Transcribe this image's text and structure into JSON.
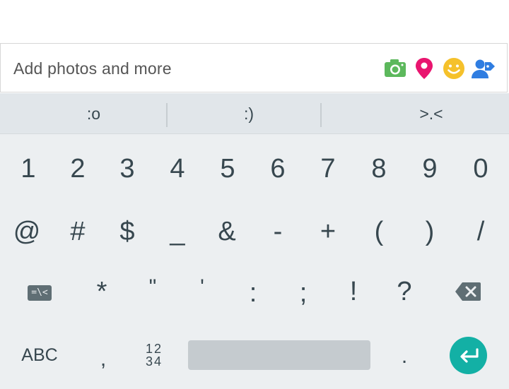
{
  "compose": {
    "placeholder": "Add photos and more",
    "icons": [
      "camera-icon",
      "location-pin-icon",
      "smiley-icon",
      "tag-person-icon"
    ],
    "colors": {
      "camera": "#5cb85c",
      "location": "#e9156f",
      "smiley": "#f5c12b",
      "tag": "#2f7de1"
    }
  },
  "suggestions": [
    ":o",
    ":)",
    ">.<"
  ],
  "keyboard": {
    "number_row": [
      "1",
      "2",
      "3",
      "4",
      "5",
      "6",
      "7",
      "8",
      "9",
      "0"
    ],
    "symbol_row1": [
      "@",
      "#",
      "$",
      "_",
      "&",
      "-",
      "+",
      "(",
      ")",
      "/"
    ],
    "mode_label": "=\\<",
    "symbol_row2": [
      "*",
      "\"",
      "'",
      ":",
      ";",
      "!",
      "?"
    ],
    "abc_label": "ABC",
    "comma": ",",
    "numpad_top": "12",
    "numpad_bottom": "34",
    "period": ".",
    "colors": {
      "background": "#eceff1",
      "suggestion_bar": "#e1e6ea",
      "key_text": "#37474f",
      "enter": "#13b0a5",
      "space": "#c5cbcf"
    }
  }
}
